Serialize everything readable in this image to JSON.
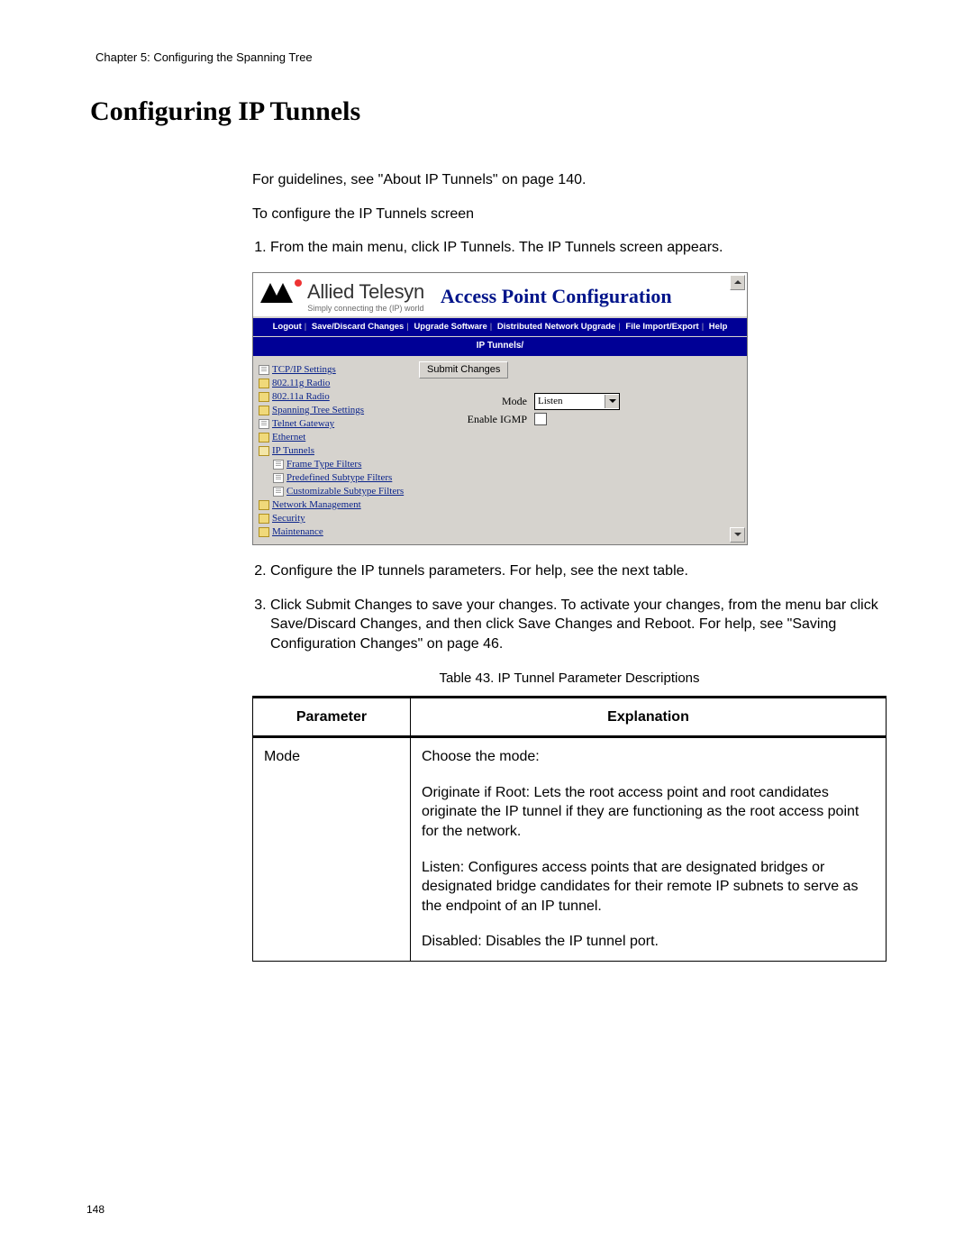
{
  "chapter_header": "Chapter 5: Configuring the Spanning Tree",
  "page_number": "148",
  "title": "Configuring IP Tunnels",
  "intro_paragraph": "For guidelines, see \"About IP Tunnels\" on page 140.",
  "intro_instruction": "To configure the IP Tunnels screen",
  "steps": {
    "s1": "From the main menu, click IP Tunnels. The IP Tunnels screen appears.",
    "s2": "Configure the IP tunnels parameters. For help, see the next table.",
    "s3": "Click Submit Changes to save your changes. To activate your changes, from the menu bar click Save/Discard Changes, and then click Save Changes and Reboot. For help, see \"Saving Configuration Changes\" on page 46."
  },
  "screenshot": {
    "brand_name": "Allied Telesyn",
    "brand_tagline": "Simply connecting the (IP) world",
    "app_title": "Access Point Configuration",
    "menubar": {
      "logout": "Logout",
      "save_discard": "Save/Discard Changes",
      "upgrade": "Upgrade Software",
      "dist_upgrade": "Distributed Network Upgrade",
      "file_io": "File Import/Export",
      "help": "Help"
    },
    "breadcrumb": "IP Tunnels/",
    "tree": {
      "tcpip": "TCP/IP Settings",
      "r11g": "802.11g Radio",
      "r11a": "802.11a Radio",
      "spanning": "Spanning Tree Settings",
      "telnet": "Telnet Gateway",
      "ethernet": "Ethernet",
      "ip_tunnels": "IP Tunnels",
      "frame_type": "Frame Type Filters",
      "predef": "Predefined Subtype Filters",
      "custom": "Customizable Subtype Filters",
      "netmgmt": "Network Management",
      "security": "Security",
      "maintenance": "Maintenance"
    },
    "form": {
      "submit_label": "Submit Changes",
      "mode_label": "Mode",
      "mode_value": "Listen",
      "igmp_label": "Enable IGMP"
    }
  },
  "table_caption": "Table 43. IP Tunnel Parameter Descriptions",
  "table": {
    "header_param": "Parameter",
    "header_expl": "Explanation",
    "row1_param": "Mode",
    "row1_expl_intro": "Choose the mode:",
    "row1_expl_orig": "Originate if Root: Lets the root access point and root candidates originate the IP tunnel if they are functioning as the root access point for the network.",
    "row1_expl_listen": "Listen: Configures access points that are designated bridges or designated bridge candidates for their remote IP subnets to serve as the endpoint of an IP tunnel.",
    "row1_expl_disabled": "Disabled: Disables the IP tunnel port."
  }
}
